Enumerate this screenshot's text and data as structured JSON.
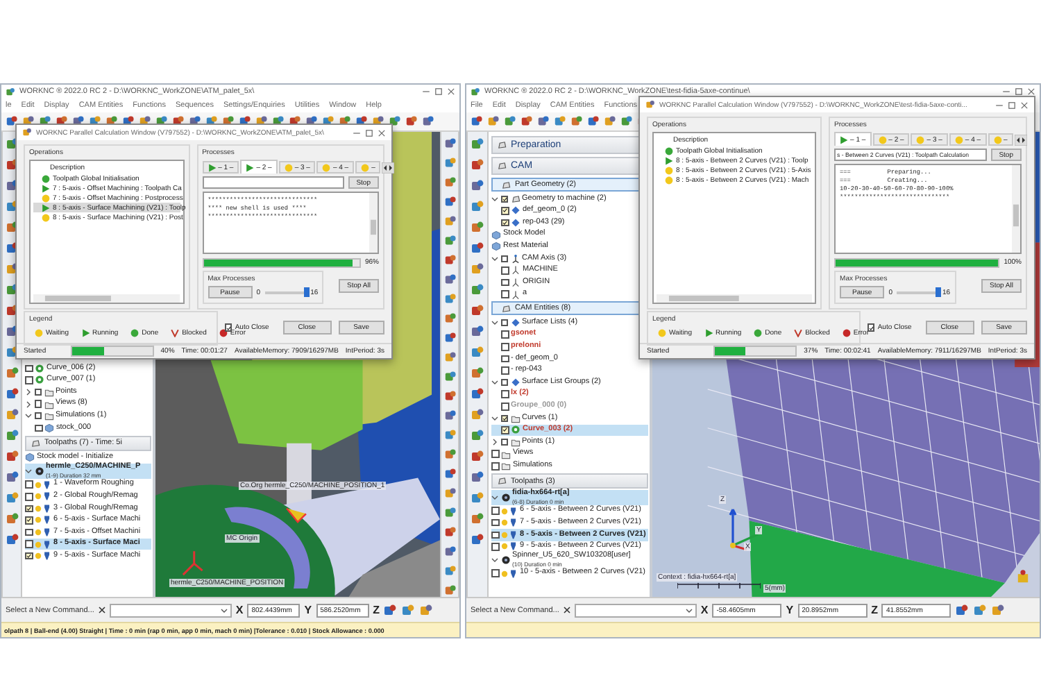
{
  "windows": [
    {
      "title": "WORKNC ® 2022.0 RC 2 - D:\\WORKNC_WorkZONE\\ATM_palet_5x\\",
      "menu": [
        "le",
        "Edit",
        "Display",
        "CAM Entities",
        "Functions",
        "Sequences",
        "Settings/Enquiries",
        "Utilities",
        "Window",
        "Help"
      ],
      "tree": [
        {
          "kind": "curve",
          "label": "Curve_006 (2)",
          "checked": false,
          "selected": false
        },
        {
          "kind": "curve",
          "label": "Curve_007 (1)",
          "checked": false,
          "selected": false
        },
        {
          "kind": "folder",
          "label": "Points",
          "expanded": false,
          "checked": false,
          "selected": false
        },
        {
          "kind": "folder",
          "label": "Views (8)",
          "expanded": false,
          "checked": false,
          "selected": false
        },
        {
          "kind": "folder",
          "label": "Simulations (1)",
          "expanded": true,
          "checked": false,
          "selected": false,
          "children": [
            {
              "kind": "stock",
              "label": "stock_000",
              "checked": false,
              "selected": false
            }
          ]
        },
        {
          "kind": "header",
          "label": "Toolpaths (7) - Time: 5i"
        },
        {
          "kind": "stock",
          "label": "Stock model - Initialize",
          "selected": false
        },
        {
          "kind": "machine",
          "label": "hermle_C250/MACHINE_P",
          "sub": "(1-9) Duration 32 mm",
          "expanded": true,
          "selected": true
        },
        {
          "kind": "toolpath",
          "label": "1 - Waveform Roughing",
          "checked": false,
          "selected": false
        },
        {
          "kind": "toolpath",
          "label": "2 - Global Rough/Remag",
          "checked": false,
          "selected": false
        },
        {
          "kind": "toolpath",
          "label": "3 - Global Rough/Remag",
          "checked": true,
          "selected": false
        },
        {
          "kind": "toolpath",
          "label": "6 - 5-axis - Surface Machi",
          "checked": true,
          "selected": false
        },
        {
          "kind": "toolpath",
          "label": "7 - 5-axis - Offset Machini",
          "checked": false,
          "selected": false
        },
        {
          "kind": "toolpath",
          "label": "8 - 5-axis - Surface Maci",
          "checked": false,
          "selected": true
        },
        {
          "kind": "toolpath",
          "label": "9 - 5-axis - Surface Machi",
          "checked": true,
          "selected": false
        }
      ],
      "viewport": {
        "kind": "machine",
        "labels": [
          {
            "kind": "tool",
            "text": "Co.Org  hermle_C250/MACHINE_POSITION_1"
          },
          {
            "kind": "origin",
            "text": "MC Origin"
          },
          {
            "kind": "base",
            "text": "hermle_C250/MACHINE_POSITION"
          }
        ]
      },
      "command": {
        "prompt": "Select a New Command...",
        "coords": [
          {
            "axis": "X",
            "value": "802.4439mm"
          },
          {
            "axis": "Y",
            "value": "586.2520mm"
          },
          {
            "axis": "Z"
          }
        ]
      },
      "status_line": "olpath 8 | Ball-end (4.00) Straight | Time : 0 min (rap 0 min, app 0 min, mach 0 min) |Tolerance : 0.010 | Stock Allowance : 0.000",
      "dialog": {
        "title": "WORKNC Parallel Calculation Window (V797552) - D:\\WORKNC_WorkZONE\\ATM_palet_5x\\",
        "operations_label": "Operations",
        "column": "Description",
        "operations": [
          {
            "kind": "done",
            "label": "Toolpath Global Initialisation",
            "selected": false
          },
          {
            "kind": "running",
            "label": "7 : 5-axis - Offset Machining : Toolpath Ca",
            "selected": false
          },
          {
            "kind": "waiting",
            "label": "7 : 5-axis - Offset Machining : Postprocess",
            "selected": false
          },
          {
            "kind": "running",
            "label": "8 : 5-axis - Surface Machining (V21) : Toolp",
            "selected": true
          },
          {
            "kind": "waiting",
            "label": "8 : 5-axis - Surface Machining (V21) : Post",
            "selected": false
          }
        ],
        "processes_label": "Processes",
        "tabs": [
          {
            "kind": "running",
            "label": "– 1 –",
            "selected": false
          },
          {
            "kind": "running",
            "label": "– 2 –",
            "selected": true
          },
          {
            "kind": "waiting",
            "label": "– 3 –",
            "selected": false
          },
          {
            "kind": "waiting",
            "label": "– 4 –",
            "selected": false
          },
          {
            "kind": "waiting",
            "label": "–",
            "selected": false
          }
        ],
        "stop": "Stop",
        "log": [
          "******************************",
          "**** new shell is used ****",
          "******************************"
        ],
        "progress": {
          "level": 0.96,
          "reading": "96%"
        },
        "max_processes": {
          "label": "Max Processes",
          "pause": "Pause",
          "min": "0",
          "max": "16",
          "level": 1
        },
        "stop_all": "Stop All",
        "legend_label": "Legend",
        "legend": [
          {
            "kind": "waiting",
            "label": "Waiting"
          },
          {
            "kind": "running",
            "label": "Running"
          },
          {
            "kind": "done",
            "label": "Done"
          },
          {
            "kind": "blocked",
            "label": "Blocked"
          },
          {
            "kind": "error",
            "label": "Error"
          }
        ],
        "auto_close": {
          "label": "Auto Close",
          "checked": true
        },
        "buttons": [
          "Close",
          "Save"
        ],
        "status": {
          "label": "Started",
          "level": 0.4,
          "reading": "40%",
          "time": "Time: 00:01:27",
          "memory": "AvailableMemory: 7909/16297MB",
          "period": "IntPeriod: 3s"
        }
      }
    },
    {
      "title": "WORKNC ® 2022.0 RC 2 - D:\\WORKNC_WorkZONE\\test-fidia-5axe-continue\\",
      "menu": [
        "File",
        "Edit",
        "Display",
        "CAM Entities",
        "Functions"
      ],
      "tree": [
        {
          "kind": "header",
          "label": "Preparation"
        },
        {
          "kind": "header",
          "label": "CAM"
        },
        {
          "kind": "group",
          "label": "Part Geometry (2)"
        },
        {
          "kind": "geometry",
          "label": "Geometry to machine (2)",
          "expanded": true,
          "checked": true,
          "selected": false,
          "children": [
            {
              "kind": "surface",
              "label": "def_geom_0 (2)",
              "checked": true,
              "selected": false
            },
            {
              "kind": "surface",
              "label": "rep-043 (29)",
              "checked": true,
              "selected": false
            }
          ]
        },
        {
          "kind": "stock",
          "label": "Stock Model",
          "selected": false
        },
        {
          "kind": "stock",
          "label": "Rest Material",
          "selected": false
        },
        {
          "kind": "axis",
          "label": "CAM Axis (3)",
          "expanded": true,
          "checked": false,
          "selected": false,
          "children": [
            {
              "kind": "frame",
              "label": "MACHINE",
              "checked": false,
              "selected": false
            },
            {
              "kind": "frame",
              "label": "ORIGIN",
              "checked": false,
              "selected": false
            },
            {
              "kind": "frame",
              "label": "a",
              "checked": false,
              "selected": false
            }
          ]
        },
        {
          "kind": "group",
          "label": "CAM Entities (8)"
        },
        {
          "kind": "surface",
          "label": "Surface Lists (4)",
          "expanded": true,
          "checked": false,
          "selected": false,
          "children": [
            {
              "kind": "item",
              "label": "gsonet",
              "checked": false,
              "color": "#c0392b",
              "selected": false
            },
            {
              "kind": "item",
              "label": "prelonni",
              "checked": false,
              "color": "#c0392b",
              "selected": false
            },
            {
              "kind": "item",
              "label": "- def_geom_0",
              "checked": false,
              "selected": false
            },
            {
              "kind": "item",
              "label": "- rep-043",
              "checked": false,
              "selected": false
            }
          ]
        },
        {
          "kind": "surface",
          "label": "Surface List Groups (2)",
          "expanded": true,
          "checked": false,
          "selected": false,
          "children": [
            {
              "kind": "item",
              "label": "lx (2)",
              "checked": false,
              "color": "#c0392b",
              "selected": false
            },
            {
              "kind": "item",
              "label": "Groupe_000 (0)",
              "checked": false,
              "color": "#999999",
              "selected": false
            }
          ]
        },
        {
          "kind": "folder",
          "label": "Curves (1)",
          "expanded": true,
          "checked": true,
          "selected": false,
          "children": [
            {
              "kind": "curve",
              "label": "Curve_003 (2)",
              "checked": true,
              "color": "#c0392b",
              "selected": true
            }
          ]
        },
        {
          "kind": "folder",
          "label": "Points (1)",
          "expanded": false,
          "checked": false,
          "selected": false
        },
        {
          "kind": "folder",
          "label": "Views",
          "checked": false,
          "selected": false
        },
        {
          "kind": "folder",
          "label": "Simulations",
          "checked": false,
          "selected": false
        },
        {
          "kind": "header",
          "label": "Toolpaths (3)"
        },
        {
          "kind": "machine",
          "label": "fidia-hx664-rt[a]",
          "sub": "(6-8) Duration 0 min",
          "expanded": true,
          "selected": true
        },
        {
          "kind": "toolpath",
          "label": "6 - 5-axis - Between 2 Curves (V21)",
          "checked": false,
          "selected": false
        },
        {
          "kind": "toolpath",
          "label": "7 - 5-axis - Between 2 Curves (V21)",
          "checked": false,
          "selected": false
        },
        {
          "kind": "toolpath",
          "label": "8 - 5-axis - Between 2 Curves (V21)",
          "checked": false,
          "selected": true
        },
        {
          "kind": "toolpath",
          "label": "9 - 5-axis - Between 2 Curves (V21)",
          "checked": false,
          "selected": false
        },
        {
          "kind": "machine",
          "label": "Spinner_U5_620_SW103208[user]",
          "sub": "(10) Duration 0 min",
          "expanded": true,
          "selected": false
        },
        {
          "kind": "toolpath",
          "label": "10 - 5-axis - Between 2 Curves (V21)",
          "checked": false,
          "selected": false
        }
      ],
      "viewport": {
        "kind": "mesh",
        "axes": [
          "Z",
          "Y",
          "X"
        ],
        "labels": [
          {
            "kind": "context",
            "text": "Context : fidia-hx664-rt[a]"
          },
          {
            "kind": "scale",
            "text": "5(mm)"
          }
        ]
      },
      "command": {
        "prompt": "Select a New Command...",
        "coords": [
          {
            "axis": "X",
            "value": "-58.4605mm"
          },
          {
            "axis": "Y",
            "value": "20.8952mm"
          },
          {
            "axis": "Z",
            "value": "41.8552mm"
          }
        ]
      },
      "dialog": {
        "title": "WORKNC Parallel Calculation Window (V797552) - D:\\WORKNC_WorkZONE\\test-fidia-5axe-conti...",
        "operations_label": "Operations",
        "column": "Description",
        "operations": [
          {
            "kind": "done",
            "label": "Toolpath Global Initialisation",
            "selected": false
          },
          {
            "kind": "running",
            "label": "8 : 5-axis - Between 2 Curves (V21) : Toolp",
            "selected": false
          },
          {
            "kind": "waiting",
            "label": "8 : 5-axis - Between 2 Curves (V21) : 5-Axis",
            "selected": false
          },
          {
            "kind": "waiting",
            "label": "8 : 5-axis - Between 2 Curves (V21) : Mach",
            "selected": false
          }
        ],
        "processes_label": "Processes",
        "tabs": [
          {
            "kind": "running",
            "label": "– 1 –",
            "selected": true
          },
          {
            "kind": "waiting",
            "label": "– 2 –",
            "selected": false
          },
          {
            "kind": "waiting",
            "label": "– 3 –",
            "selected": false
          },
          {
            "kind": "waiting",
            "label": "– 4 –",
            "selected": false
          },
          {
            "kind": "waiting",
            "label": "–",
            "selected": false
          }
        ],
        "task": "s - Between 2 Curves (V21) : Toolpath Calculation",
        "stop": "Stop",
        "log": [
          "===          Preparing...",
          "===          Creating...",
          "10-20-30-40-50-60-70-80-90-100%",
          "******************************"
        ],
        "progress": {
          "level": 1,
          "reading": "100%"
        },
        "max_processes": {
          "label": "Max Processes",
          "pause": "Pause",
          "min": "0",
          "max": "16",
          "level": 1
        },
        "stop_all": "Stop All",
        "legend_label": "Legend",
        "legend": [
          {
            "kind": "waiting",
            "label": "Waiting"
          },
          {
            "kind": "running",
            "label": "Running"
          },
          {
            "kind": "done",
            "label": "Done"
          },
          {
            "kind": "blocked",
            "label": "Blocked"
          },
          {
            "kind": "error",
            "label": "Error"
          }
        ],
        "auto_close": {
          "label": "Auto Close",
          "checked": true
        },
        "buttons": [
          "Close",
          "Save"
        ],
        "status": {
          "label": "Started",
          "level": 0.37,
          "reading": "37%",
          "time": "Time: 00:02:41",
          "memory": "AvailableMemory: 7911/16297MB",
          "period": "IntPeriod: 3s"
        }
      }
    }
  ]
}
